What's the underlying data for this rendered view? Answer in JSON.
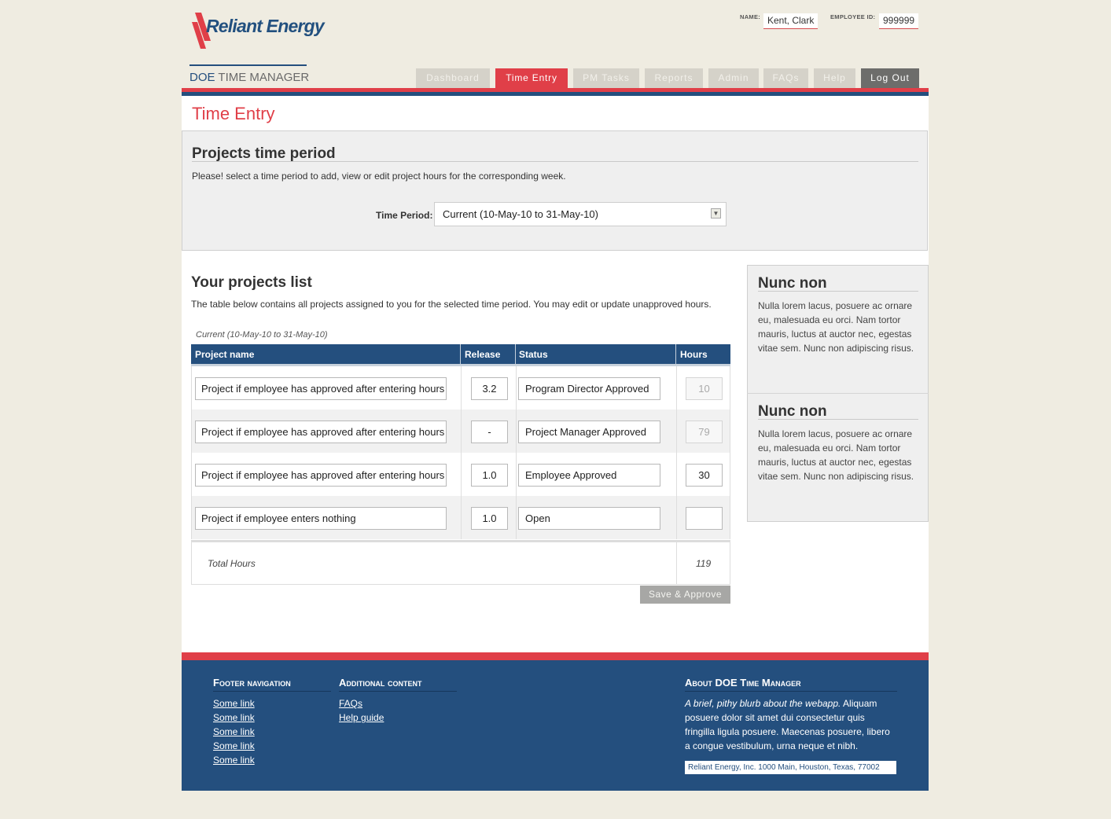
{
  "brand": {
    "logo_text": "Reliant Energy",
    "app_title_prefix": "DOE",
    "app_title_suffix": "TIME MANAGER"
  },
  "employee": {
    "name_label": "NAME:",
    "name_value": "Kent, Clark",
    "id_label": "EMPLOYEE ID:",
    "id_value": "999999"
  },
  "nav": {
    "items": [
      {
        "label": "Dashboard"
      },
      {
        "label": "Time Entry"
      },
      {
        "label": "PM Tasks"
      },
      {
        "label": "Reports"
      },
      {
        "label": "Admin"
      },
      {
        "label": "FAQs"
      },
      {
        "label": "Help"
      },
      {
        "label": "Log Out"
      }
    ],
    "active": "Time Entry"
  },
  "page": {
    "title": "Time Entry"
  },
  "period": {
    "title": "Projects time period",
    "description": "Please! select a time period to add, view or edit project hours for the corresponding week.",
    "label": "Time Period:",
    "selected": "Current (10-May-10 to 31-May-10)"
  },
  "projects": {
    "title": "Your projects list",
    "description": "The table below contains all projects assigned to you for the selected time period. You may edit or update unapproved hours.",
    "caption": "Current (10-May-10 to 31-May-10)",
    "columns": [
      "Project name",
      "Release",
      "Status",
      "Hours"
    ],
    "rows": [
      {
        "name": "Project if employee has approved after entering hours",
        "release": "3.2",
        "status": "Program Director Approved",
        "hours": "10"
      },
      {
        "name": "Project if employee has approved after entering hours",
        "release": "-",
        "status": "Project Manager Approved",
        "hours": "79"
      },
      {
        "name": "Project if employee has approved after entering hours",
        "release": "1.0",
        "status": "Employee Approved",
        "hours": "30"
      },
      {
        "name": "Project if employee enters nothing",
        "release": "1.0",
        "status": "Open",
        "hours": ""
      }
    ],
    "total_label": "Total Hours",
    "total_value": "119",
    "save_label": "Save & Approve"
  },
  "sidebar": {
    "blocks": [
      {
        "title": "Nunc non",
        "text": "Nulla lorem lacus, posuere ac ornare eu, malesuada eu orci. Nam tortor mauris, luctus at auctor nec, egestas vitae sem. Nunc non adipiscing risus."
      },
      {
        "title": "Nunc non",
        "text": "Nulla lorem lacus, posuere ac ornare eu, malesuada eu orci. Nam tortor mauris, luctus at auctor nec, egestas vitae sem. Nunc non adipiscing risus."
      }
    ]
  },
  "footer": {
    "nav_title": "Footer navigation",
    "nav_links": [
      "Some link",
      "Some link",
      "Some link",
      "Some link",
      "Some link"
    ],
    "additional_title": "Additional content",
    "additional_links": [
      "FAQs",
      "Help guide"
    ],
    "about_title": "About DOE Time Manager",
    "about_lead": "A brief, pithy blurb about the webapp.",
    "about_text": " Aliquam posuere dolor sit amet dui consectetur quis fringilla ligula posuere. Maecenas posuere, libero a congue vestibulum, urna neque et nibh.",
    "address": "Reliant Energy, Inc. 1000 Main, Houston, Texas, 77002"
  },
  "colors": {
    "brand_blue": "#244f7e",
    "accent_red": "#e03f48",
    "page_bg": "#efece1"
  },
  "icons": {
    "select_arrow": "dropdown-arrow-icon"
  }
}
